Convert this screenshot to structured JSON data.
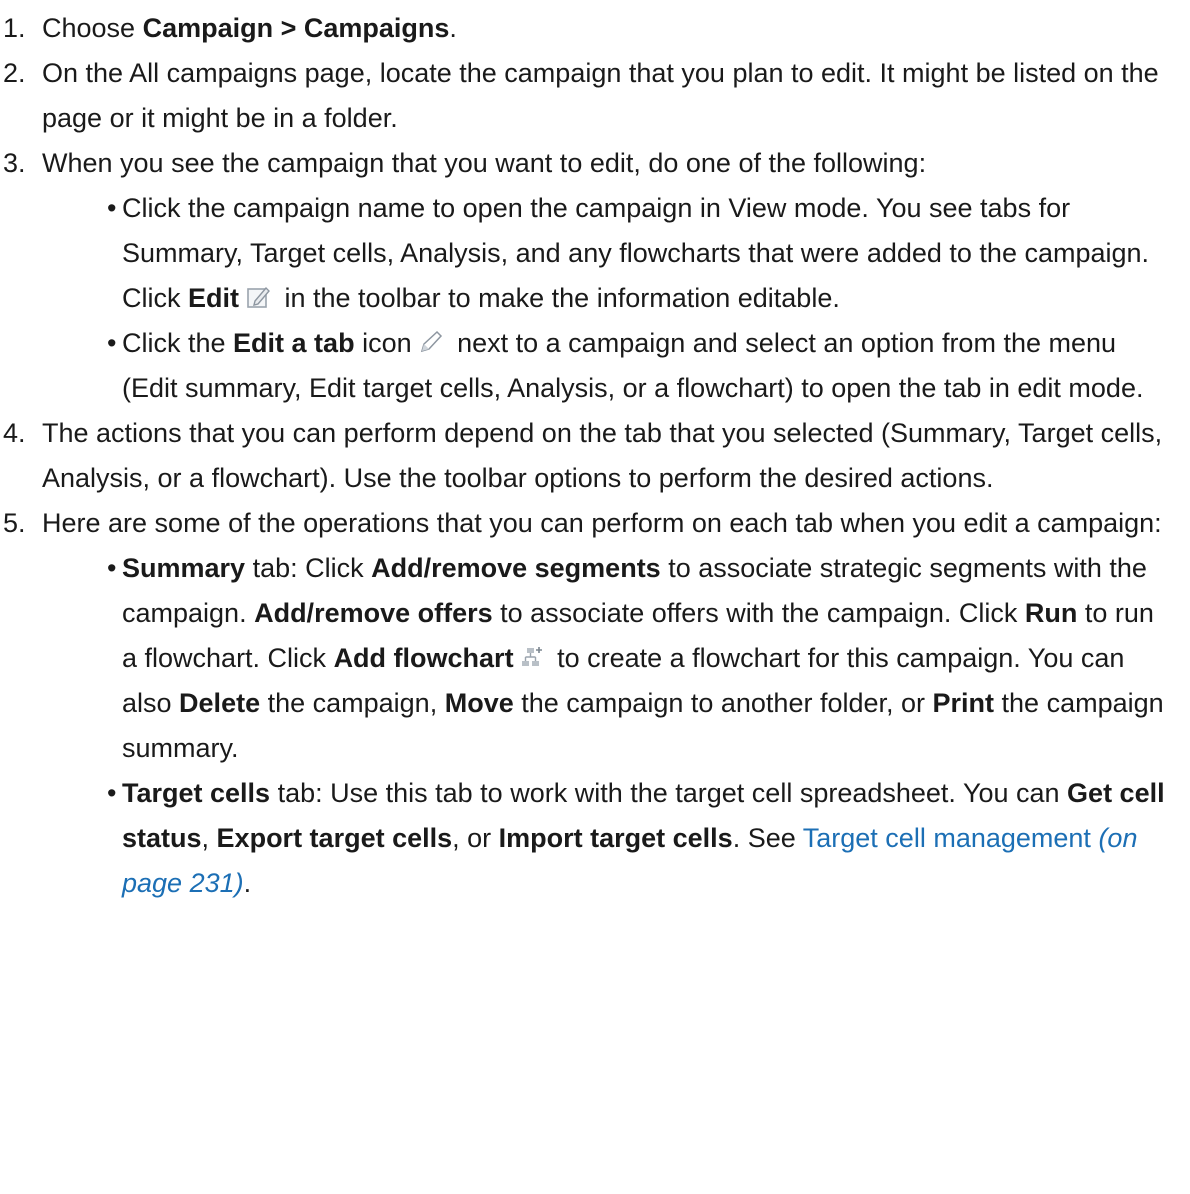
{
  "steps": [
    {
      "num": "1.",
      "pre": "Choose ",
      "b1": "Campaign > Campaigns",
      "post": "."
    },
    {
      "num": "2.",
      "text": "On the All campaigns page, locate the campaign that you plan to edit. It might be listed on the page or it might be in a folder."
    },
    {
      "num": "3.",
      "text": "When you see the campaign that you want to edit, do one of the following:",
      "bullets": [
        {
          "t1": "Click the campaign name to open the campaign in View mode. You see tabs for Summary, Target cells, Analysis, and any flowcharts that were added to the campaign. Click ",
          "b1": "Edit",
          "icon": "edit-icon",
          "t2": " in the toolbar to make the information editable."
        },
        {
          "t1": "Click the ",
          "b1": "Edit a tab",
          "t2": " icon",
          "icon": "pencil-icon",
          "t3": " next to a campaign and select an option from the menu (Edit summary, Edit target cells, Analysis, or a flowchart) to open the tab in edit mode."
        }
      ]
    },
    {
      "num": "4.",
      "text": "The actions that you can perform depend on the tab that you selected (Summary, Target cells, Analysis, or a flowchart). Use the toolbar options to perform the desired actions."
    },
    {
      "num": "5.",
      "text": "Here are some of the operations that you can perform on each tab when you edit a campaign:",
      "bullets": [
        {
          "b1": "Summary",
          "t1": " tab: Click ",
          "b2": "Add/remove segments",
          "t2": " to associate strategic segments with the campaign. ",
          "b3": "Add/remove offers",
          "t3": " to associate offers with the campaign. Click ",
          "b4": "Run",
          "t4": " to run a flowchart. Click ",
          "b5": "Add flowchart",
          "icon": "add-flowchart-icon",
          "t5": " to create a flowchart for this campaign. You can also ",
          "b6": "Delete",
          "t6": " the campaign, ",
          "b7": "Move",
          "t7": " the campaign to another folder, or ",
          "b8": "Print",
          "t8": " the campaign summary."
        },
        {
          "b1": "Target cells",
          "t1": " tab: Use this tab to work with the target cell spreadsheet. You can ",
          "b2": "Get cell status",
          "t2": ", ",
          "b3": "Export target cells",
          "t3": ", or ",
          "b4": "Import target cells",
          "t4": ". See ",
          "link": "Target cell management",
          "t5": " ",
          "ref": "(on page 231)",
          "t6": "."
        }
      ]
    }
  ],
  "bullet_char": "•",
  "colors": {
    "text": "#1a1a1a",
    "link": "#1c6fb5"
  }
}
